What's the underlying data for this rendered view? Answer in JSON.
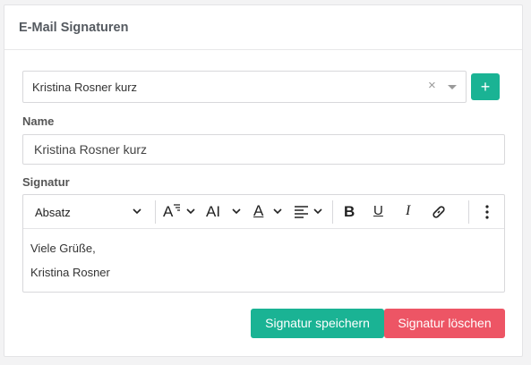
{
  "panel": {
    "title": "E-Mail Signaturen"
  },
  "selector": {
    "value": "Kristina Rosner kurz",
    "clear_symbol": "×",
    "add_symbol": "+"
  },
  "name": {
    "label": "Name",
    "value": "Kristina Rosner kurz"
  },
  "signature": {
    "label": "Signatur",
    "toolbar": {
      "paragraph_format": "Absatz",
      "font_size_glyph": "A",
      "line_height_glyph": "AI",
      "font_color_glyph": "A",
      "bold": "B",
      "underline": "U",
      "italic": "I"
    },
    "lines": [
      "Viele Grüße,",
      "Kristina Rosner"
    ]
  },
  "actions": {
    "save": "Signatur speichern",
    "delete": "Signatur löschen"
  },
  "colors": {
    "primary": "#1ab394",
    "danger": "#ed5565"
  }
}
